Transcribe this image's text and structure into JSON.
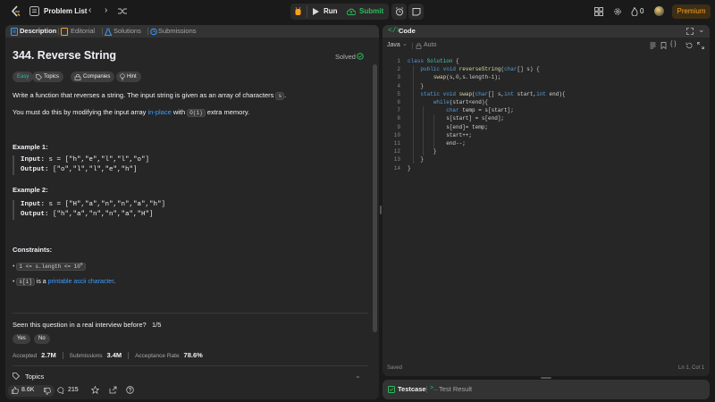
{
  "topbar": {
    "problem_list": "Problem List",
    "run": "Run",
    "submit": "Submit",
    "streak_count": "0",
    "premium": "Premium"
  },
  "left": {
    "tabs": [
      "Description",
      "Editorial",
      "Solutions",
      "Submissions"
    ],
    "title": "344. Reverse String",
    "solved": "Solved",
    "chips": [
      "Easy",
      "Topics",
      "Companies",
      "Hint"
    ],
    "desc1_a": "Write a function that reverses a string. The input string is given as an array of characters ",
    "desc1_code": "s",
    "desc1_b": ".",
    "desc2_a": "You must do this by modifying the input array ",
    "desc2_link": "in-place",
    "desc2_b": " with ",
    "desc2_code": "O(1)",
    "desc2_c": " extra memory.",
    "ex1_title": "Example 1:",
    "ex1_input_label": "Input:",
    "ex1_input": " s = [\"h\",\"e\",\"l\",\"l\",\"o\"]",
    "ex1_output_label": "Output:",
    "ex1_output": " [\"o\",\"l\",\"l\",\"e\",\"h\"]",
    "ex2_title": "Example 2:",
    "ex2_input_label": "Input:",
    "ex2_input": " s = [\"H\",\"a\",\"n\",\"n\",\"a\",\"h\"]",
    "ex2_output_label": "Output:",
    "ex2_output": " [\"h\",\"a\",\"n\",\"n\",\"a\",\"H\"]",
    "constraints_title": "Constraints:",
    "c1_code": "1 <= s.length <= 10",
    "c1_sup": "5",
    "c2_code": "s[i]",
    "c2_mid": " is a ",
    "c2_link": "printable ascii character",
    "c2_end": ".",
    "interview_q": "Seen this question in a real interview before?",
    "interview_frac": "1/5",
    "yes": "Yes",
    "no": "No",
    "accepted_label": "Accepted",
    "accepted_value": "2.7M",
    "submissions_label": "Submissions",
    "submissions_value": "3.4M",
    "acceptance_label": "Acceptance Rate",
    "acceptance_value": "78.6%",
    "topics": "Topics",
    "likes": "8.6K",
    "comments": "215"
  },
  "editor": {
    "title": "Code",
    "language": "Java",
    "auto": "Auto",
    "saved": "Saved",
    "cursor": "Ln 1, Col 1",
    "line_numbers": [
      "1",
      "2",
      "3",
      "4",
      "5",
      "6",
      "7",
      "8",
      "9",
      "10",
      "11",
      "12",
      "13",
      "14"
    ],
    "code_lines": [
      "class Solution {",
      "    public void reverseString(char[] s) {",
      "        swap(s,0,s.length-1);",
      "    }",
      "    static void swap(char[] s,int start,int end){",
      "        while(start<end){",
      "            char temp = s[start];",
      "            s[start] = s[end];",
      "            s[end]= temp;",
      "            start++;",
      "            end--;",
      "        }",
      "    }",
      "}"
    ]
  },
  "test": {
    "testcase": "Testcase",
    "test_result": "Test Result"
  },
  "colors": {
    "accent_orange": "#ffa116",
    "accent_green": "#2cbb5d",
    "link_blue": "#3b9cff",
    "easy_teal": "#2cbbad"
  }
}
